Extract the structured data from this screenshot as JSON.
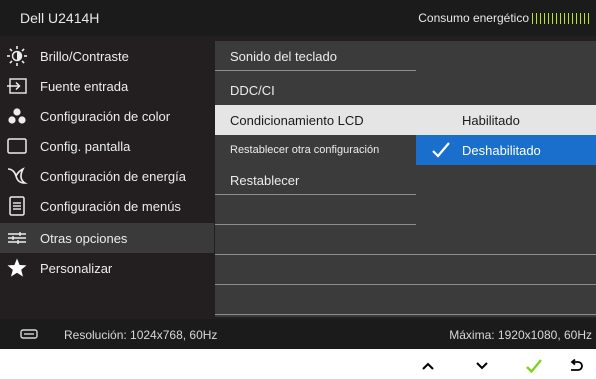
{
  "header": {
    "model": "Dell U2414H",
    "energy_label": "Consumo energético"
  },
  "menu": {
    "items": [
      {
        "label": "Brillo/Contraste",
        "icon": "brightness-icon"
      },
      {
        "label": "Fuente entrada",
        "icon": "input-source-icon"
      },
      {
        "label": "Configuración de color",
        "icon": "color-dots-icon"
      },
      {
        "label": "Config. pantalla",
        "icon": "display-rectangle-icon"
      },
      {
        "label": "Configuración de energía",
        "icon": "energy-icon"
      },
      {
        "label": "Configuración de menús",
        "icon": "menu-list-icon"
      },
      {
        "label": "Otras opciones",
        "icon": "sliders-icon",
        "active": true
      },
      {
        "label": "Personalizar",
        "icon": "star-icon"
      }
    ]
  },
  "submenu": {
    "items": [
      {
        "label": "Sonido del teclado"
      },
      {
        "label": "DDC/CI"
      },
      {
        "label": "Condicionamiento LCD",
        "highlighted": true
      },
      {
        "label": "Restablecer otra configuración"
      },
      {
        "label": "Restablecer"
      }
    ],
    "options": [
      {
        "label": "Habilitado"
      },
      {
        "label": "Deshabilitado",
        "selected": true
      }
    ]
  },
  "footer": {
    "resolution": "Resolución: 1024x768, 60Hz",
    "max": "Máxima: 1920x1080, 60Hz"
  },
  "colors": {
    "accent": "#1a6fcc",
    "check_green": "#7ed321",
    "energy_bar": "#b7e23a"
  },
  "buttons": [
    "up-arrow-icon",
    "down-arrow-icon",
    "check-icon",
    "back-icon"
  ]
}
